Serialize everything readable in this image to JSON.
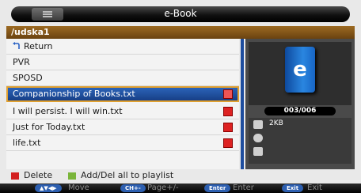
{
  "header": {
    "title": "e-Book"
  },
  "path": "/udska1",
  "list": {
    "items": [
      {
        "label": "Return",
        "type": "return"
      },
      {
        "label": "PVR",
        "type": "folder"
      },
      {
        "label": "SPOSD",
        "type": "folder"
      },
      {
        "label": "Companionship of Books.txt",
        "type": "file",
        "selected": true,
        "checked": true
      },
      {
        "label": "I will persist. I will win.txt",
        "type": "file",
        "checked": true
      },
      {
        "label": "Just for Today.txt",
        "type": "file",
        "checked": true
      },
      {
        "label": "life.txt",
        "type": "file",
        "checked": true
      }
    ]
  },
  "preview": {
    "logo_letter": "e",
    "counter": "003/006",
    "size": "2KB"
  },
  "legend": {
    "delete_label": "Delete",
    "delete_color": "#d32020",
    "playlist_label": "Add/Del all to playlist",
    "playlist_color": "#7ab53a"
  },
  "footer": {
    "move_key": "▲▼◀▶",
    "move_label": "Move",
    "page_key": "CH+-",
    "page_label": "Page+/-",
    "enter_key": "Enter",
    "enter_label": "Enter",
    "exit_key": "Exit",
    "exit_label": "Exit"
  },
  "colors": {
    "accent": "#1e4d9e",
    "selection_border": "#e0a030"
  }
}
